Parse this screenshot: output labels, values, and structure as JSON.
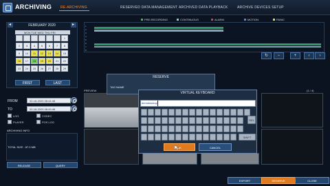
{
  "header": {
    "title": "ARCHIVING",
    "tabs": [
      {
        "label": "RE-ARCHIVING",
        "active": true
      },
      {
        "label": "RESERVED DATA MANAGEMENT",
        "active": false
      },
      {
        "label": "ARCHIVED DATA PLAYBACK",
        "active": false
      },
      {
        "label": "ARCHIVE DEVICES SETUP",
        "active": false
      }
    ]
  },
  "calendar": {
    "month": "FEBRUARY 2020",
    "weekdays": "MON TUE WED THU FRI",
    "first_label": "FIRST",
    "last_label": "LAST",
    "rows": [
      [
        "",
        "",
        "",
        "",
        "",
        "",
        "1"
      ],
      [
        "2",
        "3",
        "4",
        "5",
        "6",
        "7",
        "8"
      ],
      [
        "9",
        "10",
        "11",
        "12",
        "13",
        "14",
        "15"
      ],
      [
        "16",
        "17",
        "18",
        "19",
        "20",
        "21",
        "22"
      ],
      [
        "23",
        "24",
        "25",
        "26",
        "27",
        "28",
        "29"
      ]
    ]
  },
  "legend": [
    {
      "label": "PRE-RECORDING",
      "color": "#3fbf3f"
    },
    {
      "label": "CONTINUOUS",
      "color": "#7fd0d0"
    },
    {
      "label": "ALARM",
      "color": "#e23b3b"
    },
    {
      "label": "MOTION",
      "color": "#3d8fe0"
    },
    {
      "label": "PANIC",
      "color": "#e0e040"
    }
  ],
  "timeline": {
    "row_numbers": [
      "1",
      "2",
      "3",
      "4",
      "5",
      "6",
      "7",
      "8"
    ],
    "controls": [
      "↻",
      "−",
      "+",
      "‹",
      "›"
    ]
  },
  "range": {
    "from_label": "FROM",
    "from_value": "02-18-2020 08:44:48",
    "to_label": "TO",
    "to_value": "02-18-2020 08:49:48",
    "options": [
      "LOG",
      "CODEC",
      "PLAYER",
      "POS LOG"
    ]
  },
  "info": {
    "title": "ARCHIVING INFO",
    "total_size": "TOTAL SIZE : 87.0 MB",
    "release_label": "RELEASE",
    "query_label": "QUERY"
  },
  "preview": {
    "label": "PREVIEW",
    "page": "(1 / 4)"
  },
  "reserve": {
    "title": "RESERVE",
    "tag_label": "TAG NAME"
  },
  "keyboard": {
    "title": "VIRTUAL KEYBOARD",
    "input_value": "demobackup",
    "del_label": "DEL",
    "shift_label": "SHIFT",
    "ok_label": "OK",
    "cancel_label": "CANCEL"
  },
  "footer": {
    "export_label": "EXPORT",
    "reserve_label": "RESERVE",
    "close_label": "CLOSE"
  }
}
